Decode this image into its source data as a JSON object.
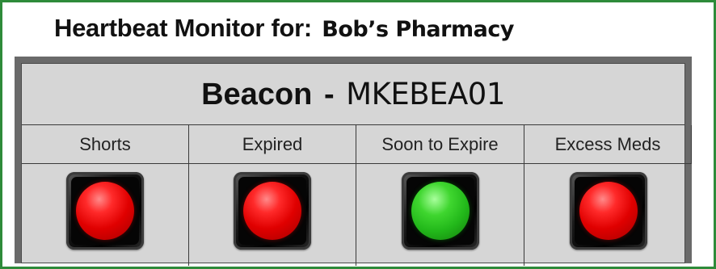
{
  "page": {
    "title_prefix": "Heartbeat Monitor for:",
    "store_name": "Bob’s Pharmacy"
  },
  "beacon": {
    "label": "Beacon",
    "separator": "-",
    "code": "MKEBEA01"
  },
  "indicators": [
    {
      "label": "Shorts",
      "status": "red",
      "icon": "red-status-light-icon"
    },
    {
      "label": "Expired",
      "status": "red",
      "icon": "red-status-light-icon"
    },
    {
      "label": "Soon to Expire",
      "status": "green",
      "icon": "green-status-light-icon"
    },
    {
      "label": "Excess Meds",
      "status": "red",
      "icon": "red-status-light-icon"
    }
  ],
  "colors": {
    "frame_border": "#2e8b3a",
    "panel_bg": "#d6d6d6",
    "panel_border": "#6a6a6a",
    "red": "#e00000",
    "green": "#22b81a"
  }
}
